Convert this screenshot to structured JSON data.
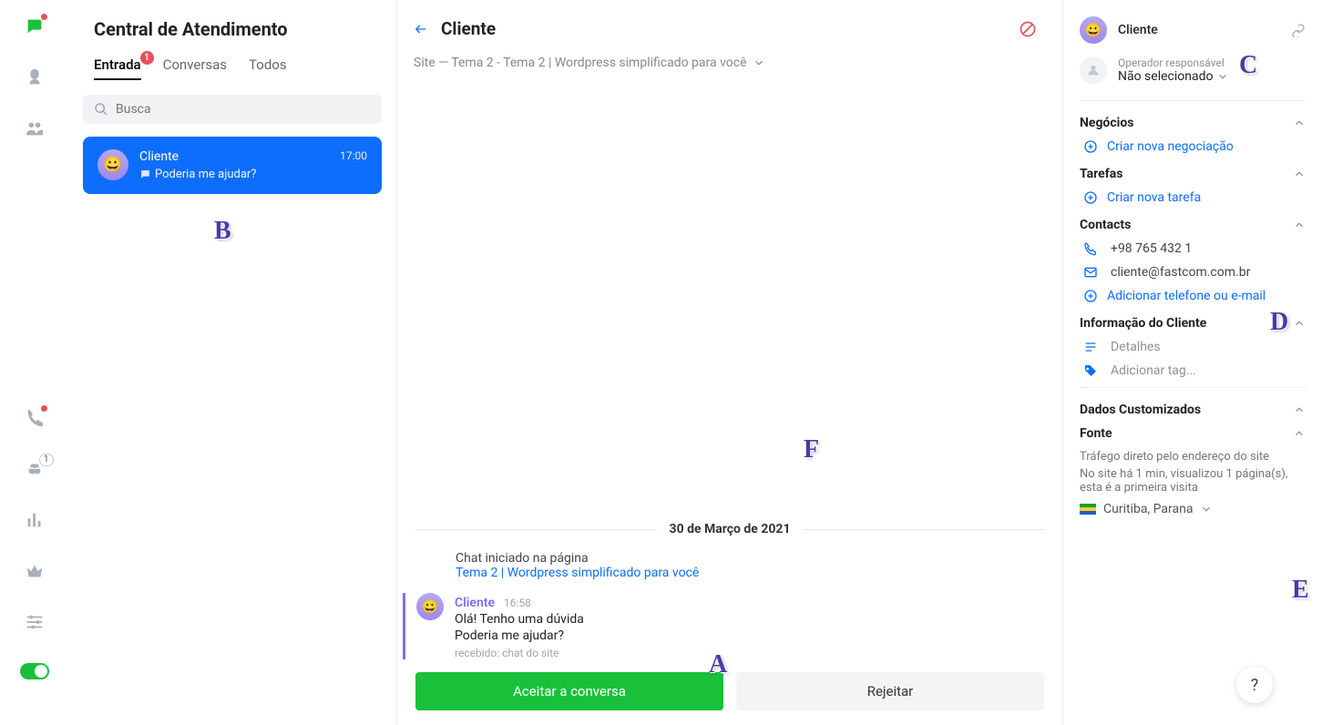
{
  "inbox": {
    "title": "Central de Atendimento",
    "tabs": [
      {
        "label": "Entrada",
        "active": true,
        "count": "1"
      },
      {
        "label": "Conversas",
        "active": false
      },
      {
        "label": "Todos",
        "active": false
      }
    ],
    "search_placeholder": "Busca",
    "item": {
      "name": "Cliente",
      "time": "17:00",
      "preview": "Poderia me ajudar?"
    }
  },
  "conv": {
    "title": "Cliente",
    "breadcrumb": "Site  —  Tema 2 - Tema 2 | Wordpress simplificado para você",
    "date_label": "30 de Março de 2021",
    "sys_prefix": "Chat iniciado na página",
    "sys_link": "Tema 2 | Wordpress simplificado para você",
    "msg": {
      "name": "Cliente",
      "time": "16:58",
      "line1": "Olá! Tenho uma dúvida",
      "line2": "Poderia me ajudar?",
      "meta": "recebido: chat do site"
    },
    "accept": "Aceitar a conversa",
    "reject": "Rejeitar"
  },
  "details": {
    "client_name": "Cliente",
    "operator_label": "Operador responsável",
    "operator_value": "Não selecionado",
    "negocios": "Negócios",
    "negocios_link": "Criar nova negociação",
    "tarefas": "Tarefas",
    "tarefas_link": "Criar nova tarefa",
    "contacts": "Contacts",
    "phone": "+98 765 432 1",
    "email": "cliente@fastcom.com.br",
    "add_contact": "Adicionar telefone ou e-mail",
    "clientinfo": "Informação do Cliente",
    "detalhes": "Detalhes",
    "addtag": "Adicionar tag...",
    "custom": "Dados Customizados",
    "fonte": "Fonte",
    "src1": "Tráfego direto pelo endereço do site",
    "src2": "No site há 1 min, visualizou 1 página(s), esta é a primeira visita",
    "location": "Curitiba, Parana"
  },
  "annotations": {
    "A": "A",
    "B": "B",
    "C": "C",
    "D": "D",
    "E": "E",
    "F": "F"
  },
  "help": "?"
}
